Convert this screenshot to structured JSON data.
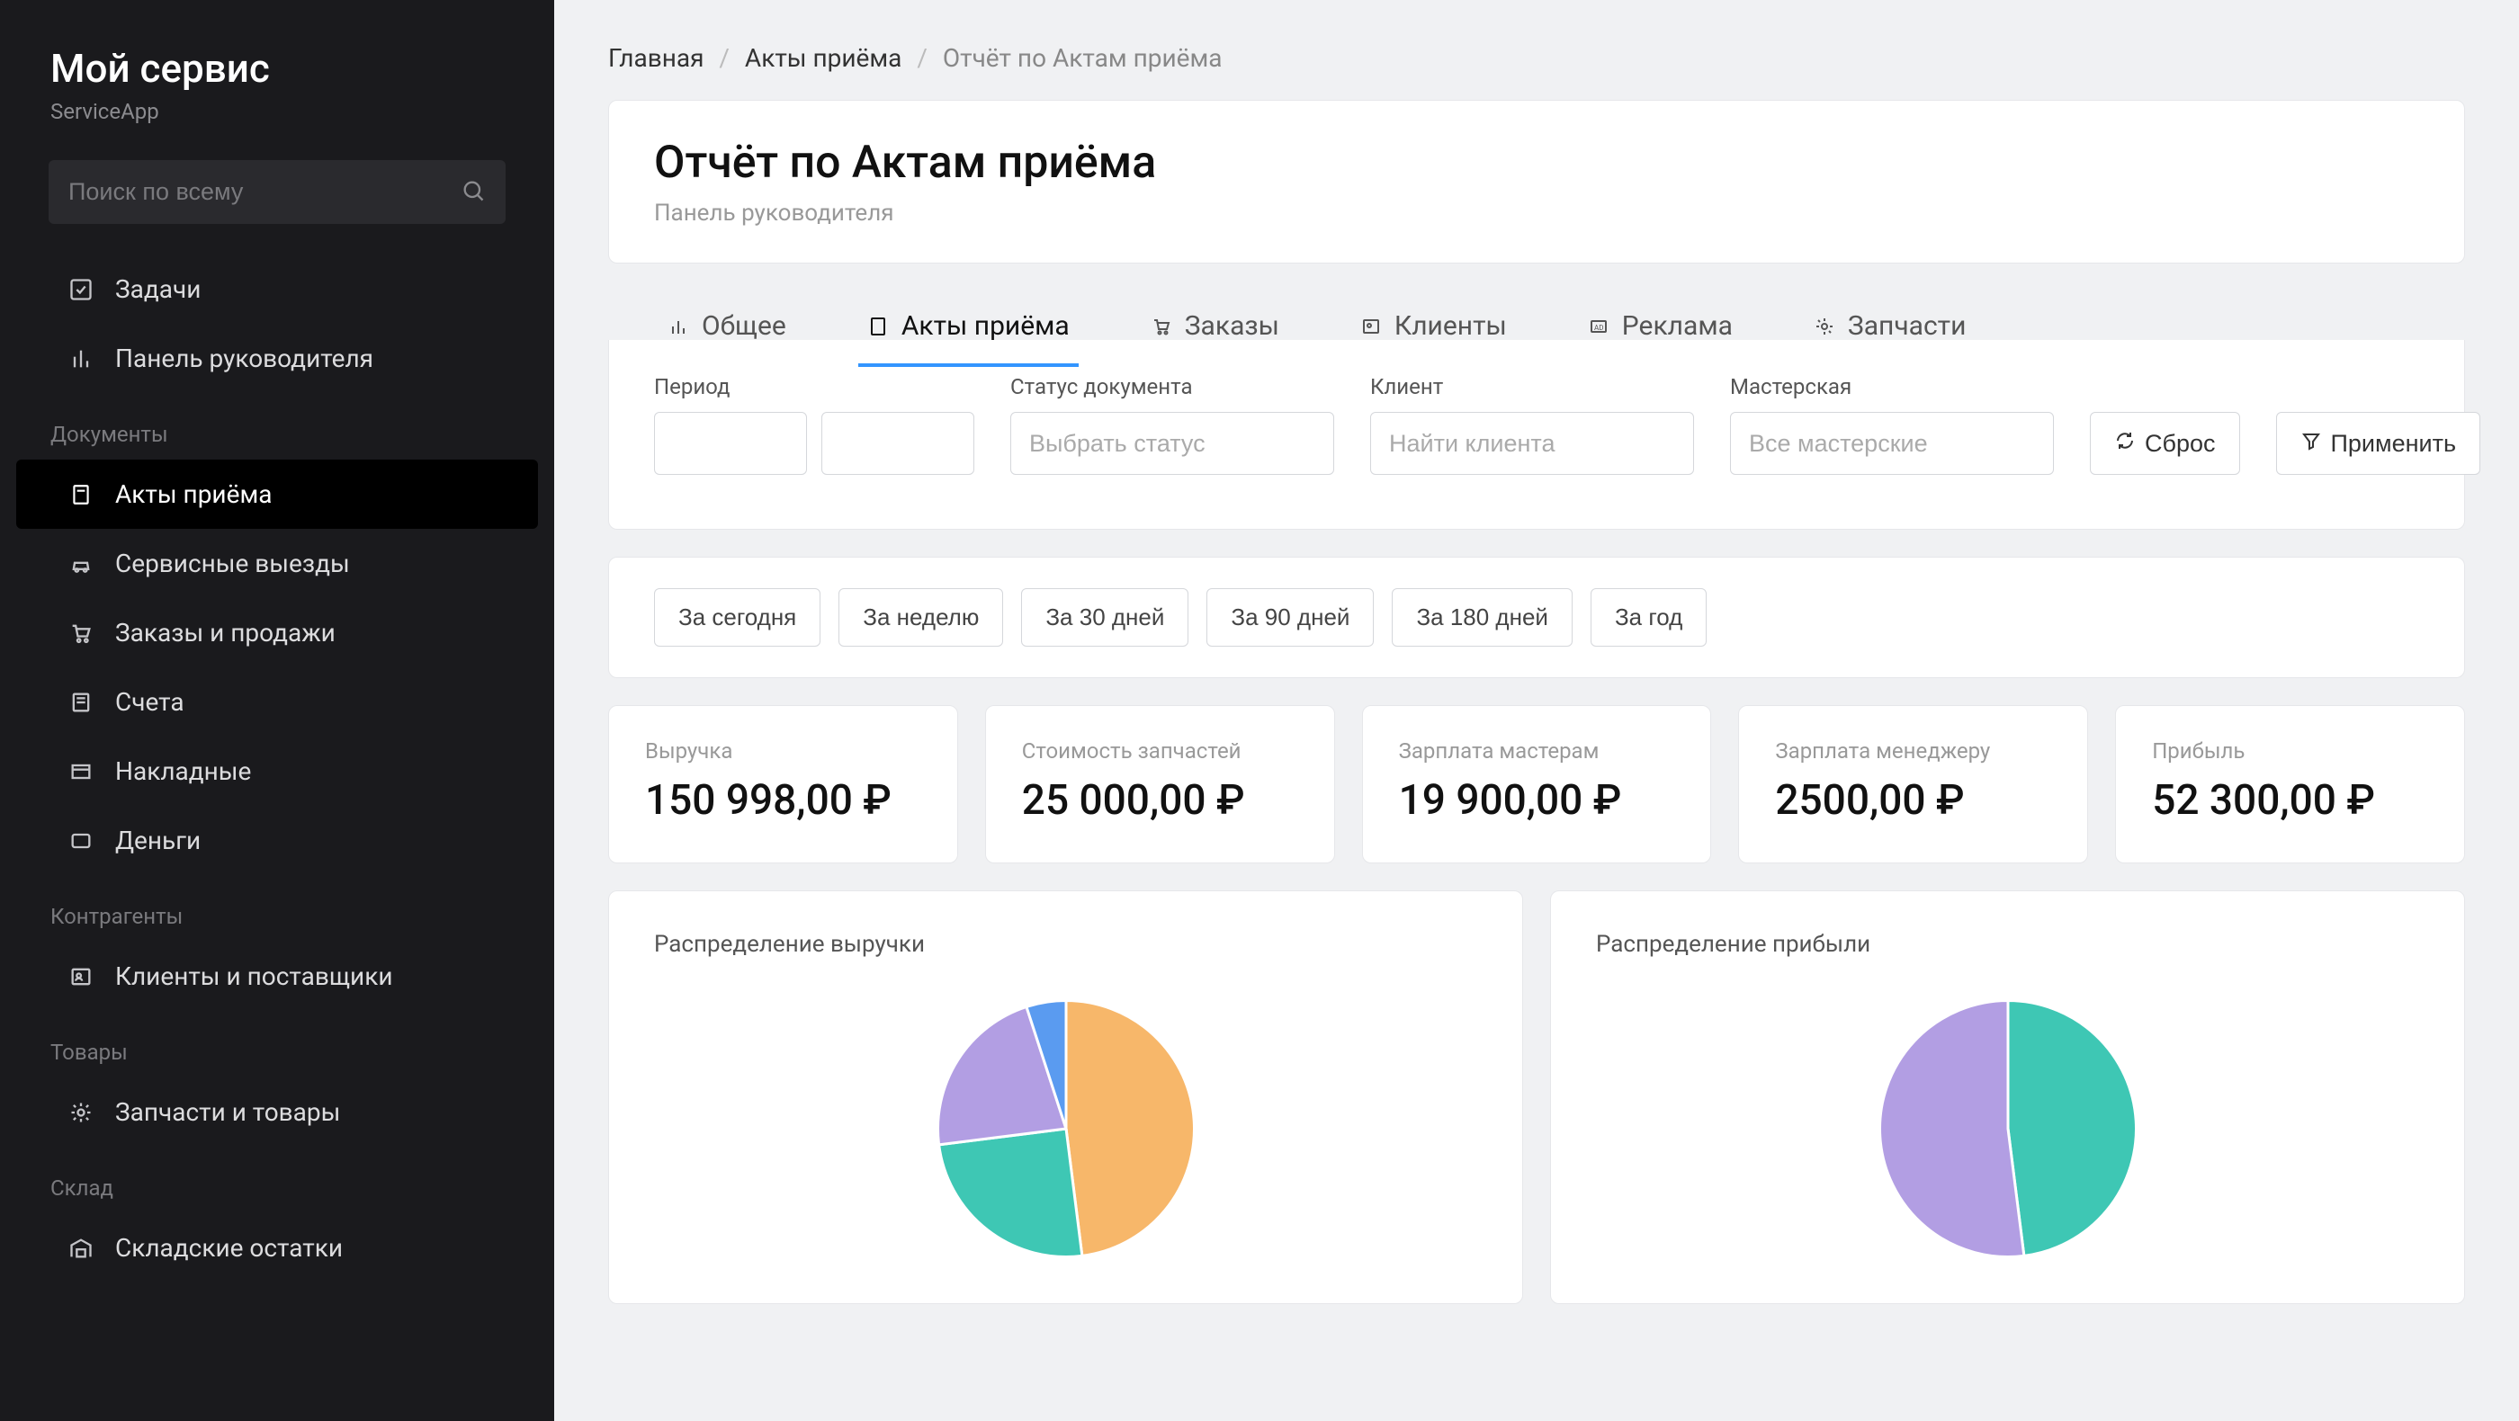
{
  "brand": {
    "title": "Мой сервис",
    "sub": "ServiceApp"
  },
  "search": {
    "placeholder": "Поиск по всему"
  },
  "sidebar": {
    "top": [
      {
        "label": "Задачи",
        "active": false
      },
      {
        "label": "Панель руководителя",
        "active": false
      }
    ],
    "sections": [
      {
        "label": "Документы",
        "items": [
          {
            "label": "Акты приёма",
            "active": true
          },
          {
            "label": "Сервисные выезды"
          },
          {
            "label": "Заказы и продажи"
          },
          {
            "label": "Счета"
          },
          {
            "label": "Накладные"
          },
          {
            "label": "Деньги"
          }
        ]
      },
      {
        "label": "Контрагенты",
        "items": [
          {
            "label": "Клиенты и поставщики"
          }
        ]
      },
      {
        "label": "Товары",
        "items": [
          {
            "label": "Запчасти и товары"
          }
        ]
      },
      {
        "label": "Склад",
        "items": [
          {
            "label": "Складские остатки"
          }
        ]
      }
    ]
  },
  "breadcrumbs": {
    "home": "Главная",
    "mid": "Акты приёма",
    "current": "Отчёт по Актам приёма"
  },
  "page": {
    "title": "Отчёт по Актам приёма",
    "sub": "Панель руководителя"
  },
  "tabs": [
    {
      "label": "Общее"
    },
    {
      "label": "Акты приёма",
      "active": true
    },
    {
      "label": "Заказы"
    },
    {
      "label": "Клиенты"
    },
    {
      "label": "Реклама"
    },
    {
      "label": "Запчасти"
    }
  ],
  "filters": {
    "period_label": "Период",
    "status_label": "Статус документа",
    "status_placeholder": "Выбрать статус",
    "client_label": "Клиент",
    "client_placeholder": "Найти клиента",
    "shop_label": "Мастерская",
    "shop_placeholder": "Все мастерские",
    "reset": "Сброс",
    "apply": "Применить"
  },
  "chips": [
    "За сегодня",
    "За неделю",
    "За 30 дней",
    "За 90 дней",
    "За 180 дней",
    "За год"
  ],
  "kpis": [
    {
      "label": "Выручка",
      "value": "150 998,00 ₽"
    },
    {
      "label": "Стоимость запчастей",
      "value": "25 000,00 ₽"
    },
    {
      "label": "Зарплата мастерам",
      "value": "19 900,00 ₽"
    },
    {
      "label": "Зарплата менеджеру",
      "value": "2500,00 ₽"
    },
    {
      "label": "Прибыль",
      "value": "52 300,00 ₽"
    }
  ],
  "charts": {
    "revenue": {
      "title": "Распределение выручки"
    },
    "profit": {
      "title": "Распределение прибыли"
    }
  },
  "colors": {
    "orange": "#f7b76a",
    "teal": "#3ec7b4",
    "violet": "#b29ee3",
    "blue": "#5a9bf0"
  },
  "chart_data": [
    {
      "type": "pie",
      "title": "Распределение выручки",
      "series": [
        {
          "name": "orange",
          "value": 48,
          "color": "#f7b76a"
        },
        {
          "name": "teal",
          "value": 25,
          "color": "#3ec7b4"
        },
        {
          "name": "violet",
          "value": 22,
          "color": "#b29ee3"
        },
        {
          "name": "blue",
          "value": 5,
          "color": "#5a9bf0"
        }
      ]
    },
    {
      "type": "pie",
      "title": "Распределение прибыли",
      "series": [
        {
          "name": "teal",
          "value": 48,
          "color": "#3ec7b4"
        },
        {
          "name": "violet",
          "value": 52,
          "color": "#b29ee3"
        }
      ]
    }
  ]
}
